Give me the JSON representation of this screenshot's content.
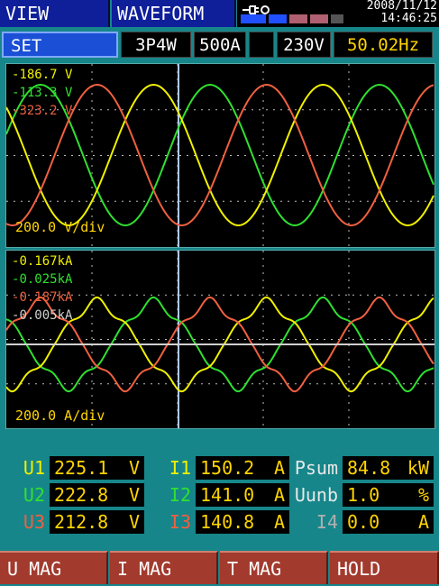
{
  "tabs": {
    "view": "VIEW",
    "mode": "WAVEFORM"
  },
  "status": {
    "date": "2008/11/12",
    "time": "14:46:25"
  },
  "setup": {
    "set": "SET",
    "wiring": "3P4W",
    "range_current": "500A",
    "blank": "",
    "range_voltage": "230V",
    "frequency": "50.02Hz"
  },
  "voltage_plot": {
    "traces": [
      {
        "value": "186.7 V",
        "color": "#f0f000"
      },
      {
        "value": "113.3 V",
        "color": "#30e030"
      },
      {
        "value": "323.2 V",
        "color": "#f06040"
      }
    ],
    "scale": "200.0 V/div"
  },
  "current_plot": {
    "traces": [
      {
        "value": "0.167kA",
        "color": "#f0f000"
      },
      {
        "value": "0.025kA",
        "color": "#30e030"
      },
      {
        "value": "0.187kA",
        "color": "#f06040"
      },
      {
        "value": "0.005kA",
        "color": "#d0d0d0"
      }
    ],
    "scale": "200.0 A/div"
  },
  "measurements": {
    "rows": [
      {
        "ulabel": "U1",
        "uvalue": "225.1",
        "uunit": "V",
        "ilabel": "I1",
        "ivalue": "150.2",
        "iunit": "A",
        "xlabel": "Psum",
        "xvalue": "84.8",
        "xunit": "kW"
      },
      {
        "ulabel": "U2",
        "uvalue": "222.8",
        "uunit": "V",
        "ilabel": "I2",
        "ivalue": "141.0",
        "iunit": "A",
        "xlabel": "Uunb",
        "xvalue": "1.0",
        "xunit": "%"
      },
      {
        "ulabel": "U3",
        "uvalue": "212.8",
        "uunit": "V",
        "ilabel": "I3",
        "ivalue": "140.8",
        "iunit": "A",
        "xlabel": "I4",
        "xvalue": "0.0",
        "xunit": "A"
      }
    ],
    "colors": {
      "p1": "#f0f000",
      "p2": "#30e030",
      "p3": "#f06040",
      "misc": "#e8e8e8",
      "neutral": "#b0b0b0"
    }
  },
  "buttons": {
    "u_mag": "U MAG",
    "i_mag": "I MAG",
    "t_mag": "T MAG",
    "hold": "HOLD"
  }
}
